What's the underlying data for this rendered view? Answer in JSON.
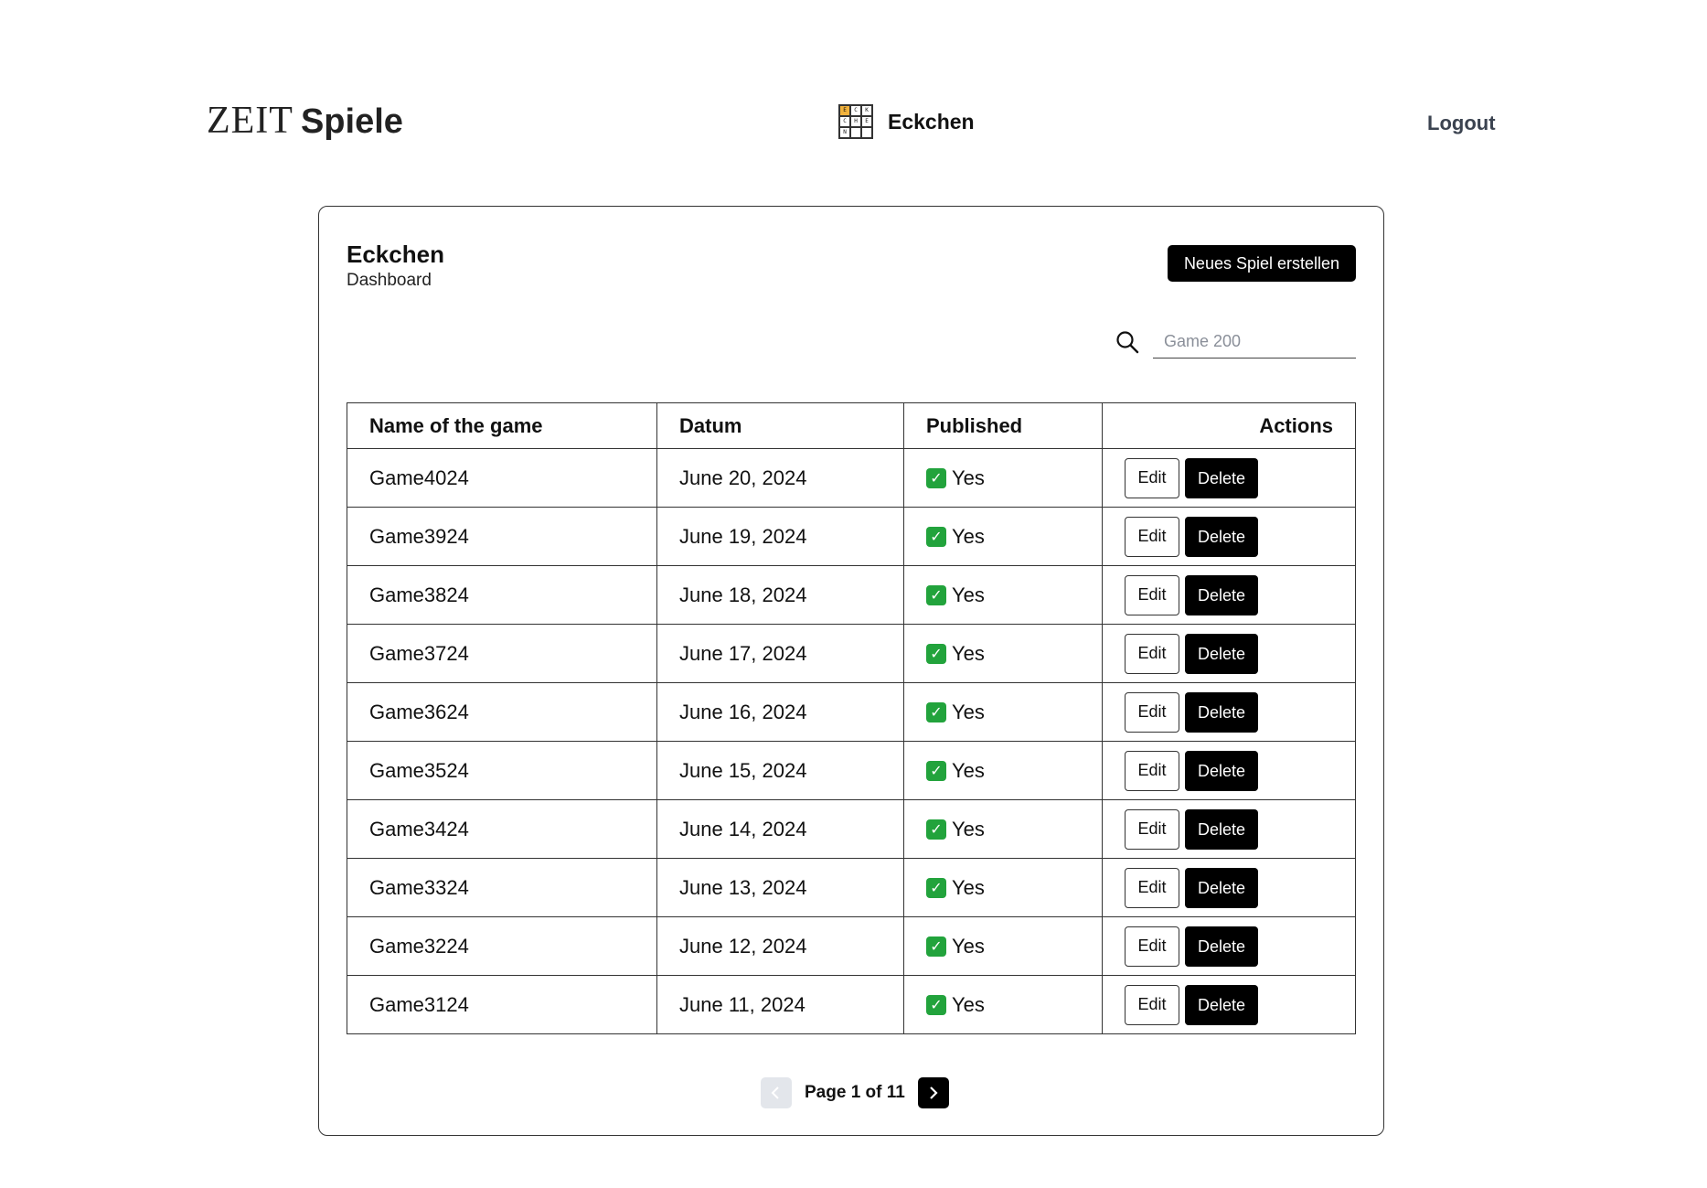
{
  "header": {
    "logo_zeit": "ZEIT",
    "logo_spiele": "Spiele",
    "game_name": "Eckchen",
    "game_icon_letters": [
      "E",
      "C",
      "K",
      "C",
      "H",
      "E",
      "N",
      "",
      ""
    ],
    "logout_label": "Logout"
  },
  "dashboard": {
    "title": "Eckchen",
    "subtitle": "Dashboard",
    "new_game_label": "Neues Spiel erstellen",
    "search": {
      "placeholder": "Game 200",
      "value": ""
    }
  },
  "table": {
    "columns": [
      "Name of the game",
      "Datum",
      "Published",
      "Actions"
    ],
    "rows": [
      {
        "name": "Game4024",
        "date": "June 20, 2024",
        "published": "Yes"
      },
      {
        "name": "Game3924",
        "date": "June 19, 2024",
        "published": "Yes"
      },
      {
        "name": "Game3824",
        "date": "June 18, 2024",
        "published": "Yes"
      },
      {
        "name": "Game3724",
        "date": "June 17, 2024",
        "published": "Yes"
      },
      {
        "name": "Game3624",
        "date": "June 16, 2024",
        "published": "Yes"
      },
      {
        "name": "Game3524",
        "date": "June 15, 2024",
        "published": "Yes"
      },
      {
        "name": "Game3424",
        "date": "June 14, 2024",
        "published": "Yes"
      },
      {
        "name": "Game3324",
        "date": "June 13, 2024",
        "published": "Yes"
      },
      {
        "name": "Game3224",
        "date": "June 12, 2024",
        "published": "Yes"
      },
      {
        "name": "Game3124",
        "date": "June 11, 2024",
        "published": "Yes"
      }
    ],
    "edit_label": "Edit",
    "delete_label": "Delete",
    "published_icon": "check-icon"
  },
  "pagination": {
    "label": "Page 1 of 11",
    "prev_enabled": false,
    "next_enabled": true
  }
}
